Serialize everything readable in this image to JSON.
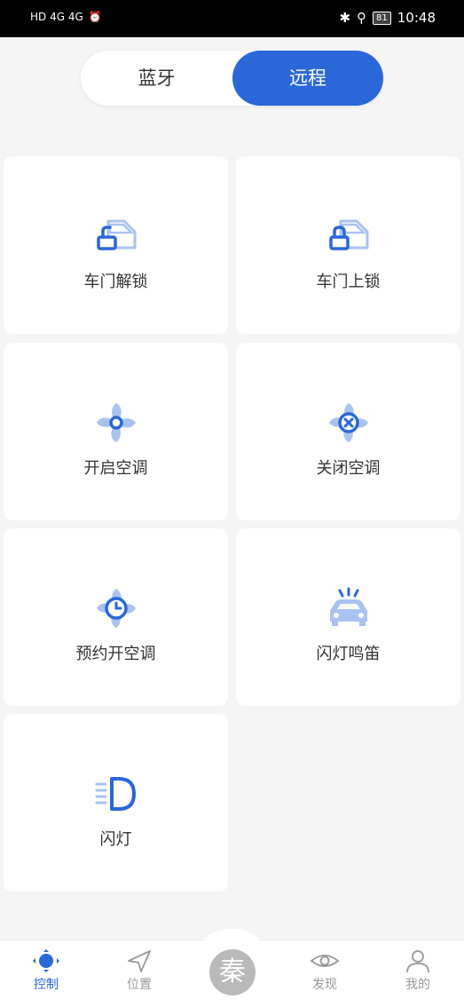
{
  "status_bar": {
    "left": "HD 4G 4G",
    "battery": "81",
    "time": "10:48"
  },
  "mode_toggle": {
    "bluetooth": "蓝牙",
    "remote": "远程"
  },
  "cards": [
    {
      "label": "车门解锁",
      "icon": "door-unlock-icon"
    },
    {
      "label": "车门上锁",
      "icon": "door-lock-icon"
    },
    {
      "label": "开启空调",
      "icon": "ac-on-icon"
    },
    {
      "label": "关闭空调",
      "icon": "ac-off-icon"
    },
    {
      "label": "预约开空调",
      "icon": "ac-schedule-icon"
    },
    {
      "label": "闪灯鸣笛",
      "icon": "flash-horn-icon"
    },
    {
      "label": "闪灯",
      "icon": "headlight-icon"
    }
  ],
  "nav": {
    "control": "控制",
    "location": "位置",
    "center": "秦",
    "discover": "发现",
    "mine": "我的"
  },
  "colors": {
    "accent": "#2a67d8",
    "light_accent": "#a9c3f0"
  }
}
